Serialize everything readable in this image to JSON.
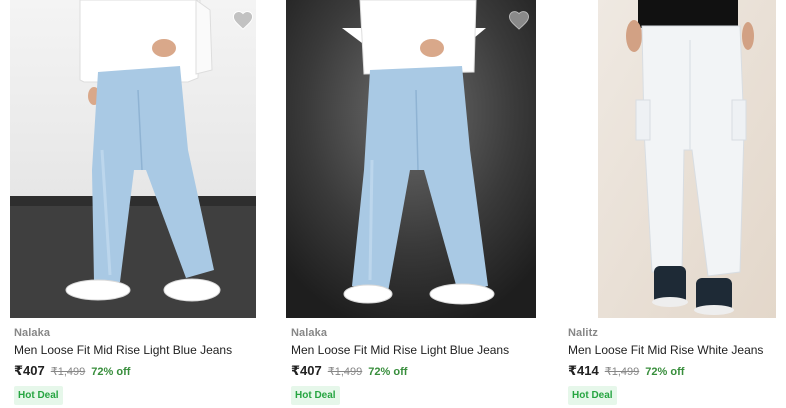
{
  "products": [
    {
      "brand": "Nalaka",
      "title": "Men Loose Fit Mid Rise Light Blue Jeans",
      "price": "₹407",
      "mrp": "₹1,499",
      "discount": "72% off",
      "badge": "Hot Deal",
      "wishlist_icon": "heart-icon",
      "jeans_color": "#a9c9e4",
      "bg": "studio-light"
    },
    {
      "brand": "Nalaka",
      "title": "Men Loose Fit Mid Rise Light Blue Jeans",
      "price": "₹407",
      "mrp": "₹1,499",
      "discount": "72% off",
      "badge": "Hot Deal",
      "wishlist_icon": "heart-icon",
      "jeans_color": "#a9c9e4",
      "bg": "studio-dark"
    },
    {
      "brand": "Nalitz",
      "title": "Men Loose Fit Mid Rise White Jeans",
      "price": "₹414",
      "mrp": "₹1,499",
      "discount": "72% off",
      "badge": "Hot Deal",
      "jeans_color": "#f2f4f6",
      "bg": "beige"
    }
  ],
  "colors": {
    "discount": "#388e3c",
    "badge_bg": "#e6f7ea",
    "badge_text": "#26a541",
    "brand": "#878787"
  }
}
